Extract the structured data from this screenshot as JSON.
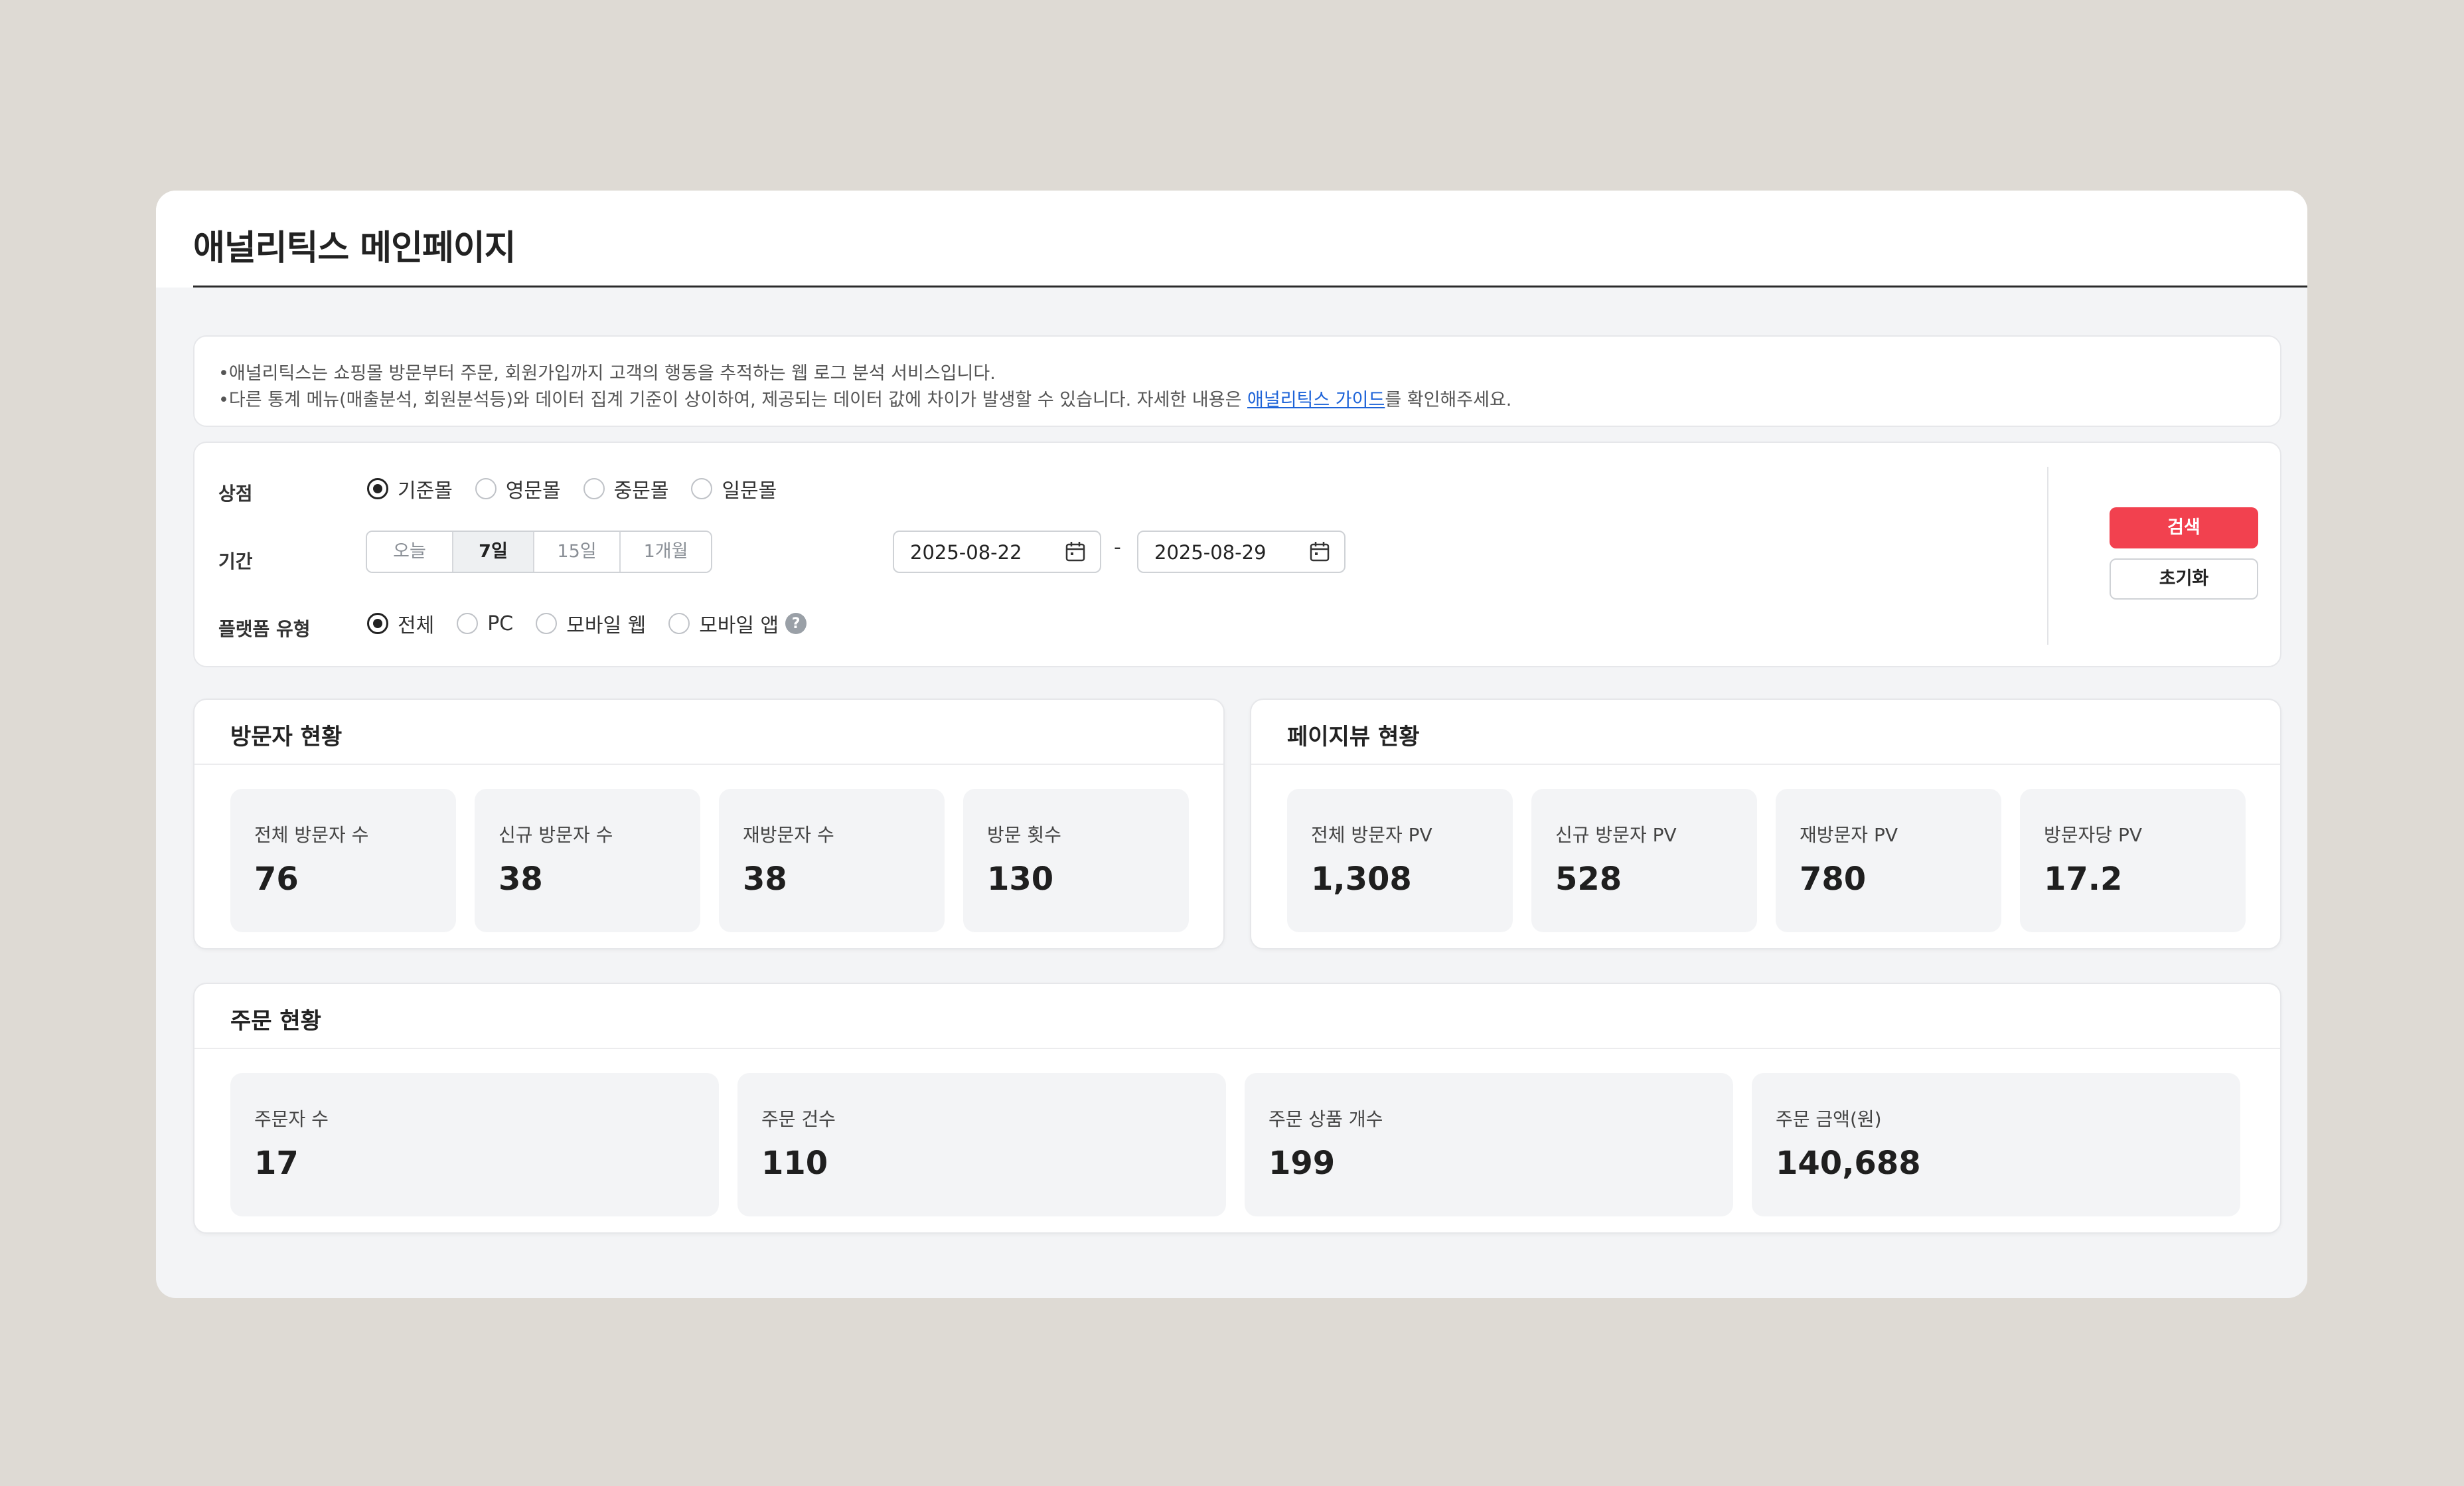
{
  "page": {
    "title": "애널리틱스 메인페이지"
  },
  "notice": {
    "line1": "•애널리틱스는 쇼핑몰 방문부터 주문, 회원가입까지 고객의 행동을 추적하는 웹 로그 분석 서비스입니다.",
    "line2_prefix": "•다른 통계 메뉴(매출분석, 회원분석등)와 데이터 집계 기준이 상이하여, 제공되는 데이터 값에 차이가 발생할 수 있습니다. 자세한 내용은 ",
    "link": "애널리틱스 가이드",
    "line2_suffix": "를 확인해주세요."
  },
  "filters": {
    "store": {
      "label": "상점",
      "options": [
        "기준몰",
        "영문몰",
        "중문몰",
        "일문몰"
      ],
      "selected": "기준몰"
    },
    "period": {
      "label": "기간",
      "presets": [
        "오늘",
        "7일",
        "15일",
        "1개월"
      ],
      "active": "7일",
      "start": "2025-08-22",
      "end": "2025-08-29",
      "separator": "-"
    },
    "platform": {
      "label": "플랫폼 유형",
      "options": [
        "전체",
        "PC",
        "모바일 웹",
        "모바일 앱"
      ],
      "selected": "전체"
    },
    "search_label": "검색",
    "reset_label": "초기화"
  },
  "visitors": {
    "title": "방문자 현황",
    "metrics": [
      {
        "label": "전체 방문자 수",
        "value": "76"
      },
      {
        "label": "신규 방문자 수",
        "value": "38"
      },
      {
        "label": "재방문자 수",
        "value": "38"
      },
      {
        "label": "방문 횟수",
        "value": "130"
      }
    ]
  },
  "pageviews": {
    "title": "페이지뷰 현황",
    "metrics": [
      {
        "label": "전체 방문자 PV",
        "value": "1,308"
      },
      {
        "label": "신규 방문자 PV",
        "value": "528"
      },
      {
        "label": "재방문자 PV",
        "value": "780"
      },
      {
        "label": "방문자당 PV",
        "value": "17.2"
      }
    ]
  },
  "orders": {
    "title": "주문 현황",
    "metrics": [
      {
        "label": "주문자 수",
        "value": "17"
      },
      {
        "label": "주문 건수",
        "value": "110"
      },
      {
        "label": "주문 상품 개수",
        "value": "199"
      },
      {
        "label": "주문 금액(원)",
        "value": "140,688"
      }
    ]
  },
  "colors": {
    "accent": "#f2414f",
    "link": "#1d63d8"
  },
  "icons": {
    "calendar": "calendar-icon",
    "help": "help-icon"
  }
}
